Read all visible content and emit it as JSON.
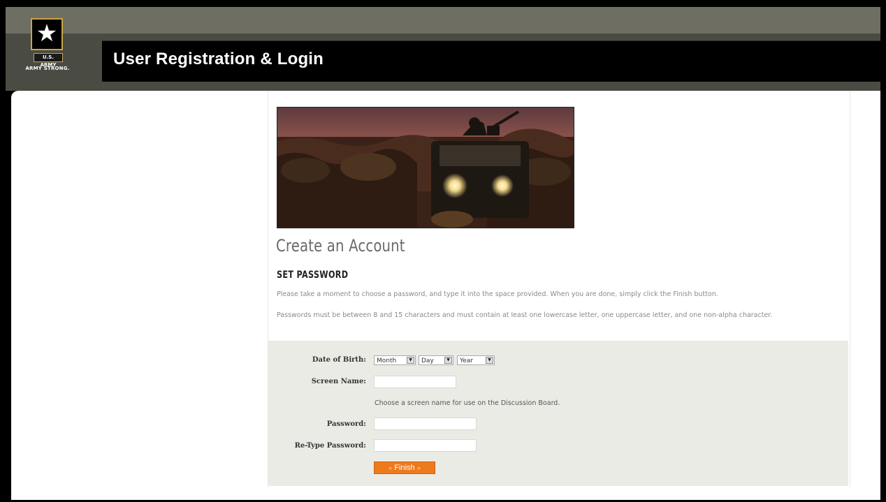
{
  "header": {
    "title": "User Registration & Login",
    "logo": {
      "badge": "U.S. ARMY",
      "tagline": "ARMY STRONG."
    }
  },
  "main": {
    "heading": "Create an Account",
    "subheading": "SET PASSWORD",
    "paragraph1": "Please take a moment to choose a password, and type it into the space provided. When you are done, simply click the Finish button.",
    "paragraph2": "Passwords must be between 8 and 15 characters and must contain at least one lowercase letter, one uppercase letter, and one non-alpha character."
  },
  "form": {
    "dob_label": "Date of Birth:",
    "month": "Month",
    "day": "Day",
    "year": "Year",
    "screen_name_label": "Screen Name:",
    "screen_name_hint": "Choose a screen name for use on the Discussion Board.",
    "password_label": "Password:",
    "retype_label": "Re-Type Password:",
    "finish_label": "Finish"
  },
  "colors": {
    "accent": "#ee7a1e",
    "header": "#000000",
    "band": "#4a4b42"
  },
  "icons": {
    "logo": "army-star-icon",
    "dropdown": "dropdown-arrow-icon",
    "finish": "chevron-icon"
  }
}
